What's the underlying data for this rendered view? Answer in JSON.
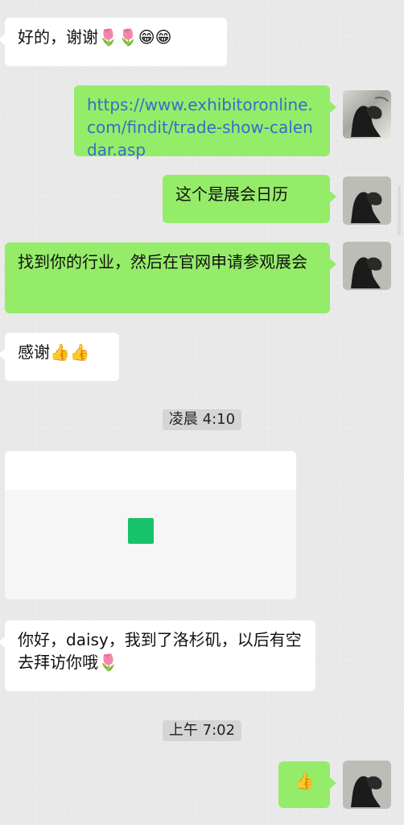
{
  "messages": [
    {
      "id": "m1",
      "side": "incoming",
      "text": "好的，谢谢🌷🌷😁😁"
    },
    {
      "id": "m2",
      "side": "outgoing",
      "text": "https://www.exhibitoronline.com/findit/trade-show-calendar.asp",
      "is_link": true
    },
    {
      "id": "m3",
      "side": "outgoing",
      "text": "这个是展会日历"
    },
    {
      "id": "m4",
      "side": "outgoing",
      "text": "找到你的行业，然后在官网申请参观展会"
    },
    {
      "id": "m5",
      "side": "incoming",
      "text": "感谢👍👍"
    }
  ],
  "timestamps": {
    "first": "凌晨 4:10",
    "second": "上午 7:02"
  },
  "card_message": {
    "preview_text": ""
  },
  "messages_after_card": [
    {
      "id": "m6",
      "side": "incoming",
      "text": "你好，daisy，我到了洛杉矶，以后有空去拜访你哦🌷"
    }
  ],
  "final_message": {
    "id": "m7",
    "side": "outgoing",
    "text": "👍"
  },
  "colors": {
    "background": "#e9e9e9",
    "incoming_bubble": "#ffffff",
    "outgoing_bubble": "#95ec69",
    "link": "#3a6cc8",
    "timestamp_bg": "#d2d2d2",
    "card_square": "#18c26b"
  },
  "icons": {
    "tulip": "tulip-icon",
    "grin": "grin-icon",
    "thumb": "thumbs-up-icon",
    "avatar": "avatar-icon"
  }
}
